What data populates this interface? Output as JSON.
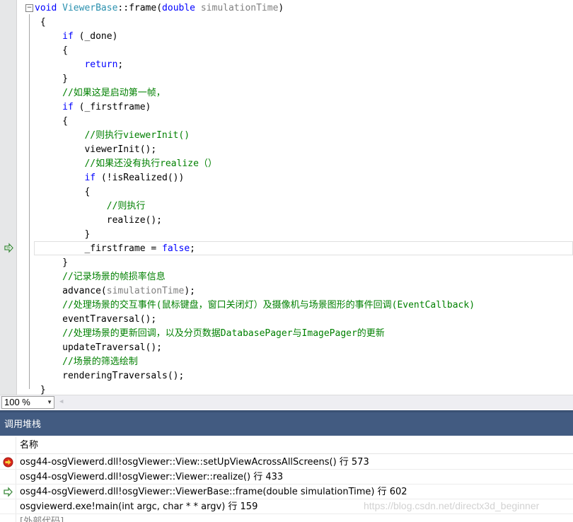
{
  "editor": {
    "lines": [
      [
        {
          "t": "void",
          "c": "kw"
        },
        {
          "t": " "
        },
        {
          "t": "ViewerBase",
          "c": "ty"
        },
        {
          "t": "::frame("
        },
        {
          "t": "double",
          "c": "kw"
        },
        {
          "t": " "
        },
        {
          "t": "simulationTime",
          "c": "pm"
        },
        {
          "t": ")"
        }
      ],
      [
        {
          "t": " {"
        }
      ],
      [
        {
          "t": "     "
        },
        {
          "t": "if",
          "c": "kw"
        },
        {
          "t": " (_done)"
        }
      ],
      [
        {
          "t": "     {"
        }
      ],
      [
        {
          "t": "         "
        },
        {
          "t": "return",
          "c": "kw"
        },
        {
          "t": ";"
        }
      ],
      [
        {
          "t": "     }"
        }
      ],
      [
        {
          "t": "     "
        },
        {
          "t": "//如果这是启动第一帧，",
          "c": "cm"
        }
      ],
      [
        {
          "t": "     "
        },
        {
          "t": "if",
          "c": "kw"
        },
        {
          "t": " (_firstframe)"
        }
      ],
      [
        {
          "t": "     {"
        }
      ],
      [
        {
          "t": "         "
        },
        {
          "t": "//则执行viewerInit()",
          "c": "cm"
        }
      ],
      [
        {
          "t": "         viewerInit();"
        }
      ],
      [
        {
          "t": "         "
        },
        {
          "t": "//如果还没有执行realize（）",
          "c": "cm"
        }
      ],
      [
        {
          "t": "         "
        },
        {
          "t": "if",
          "c": "kw"
        },
        {
          "t": " (!isRealized())"
        }
      ],
      [
        {
          "t": "         {"
        }
      ],
      [
        {
          "t": "             "
        },
        {
          "t": "//则执行",
          "c": "cm"
        }
      ],
      [
        {
          "t": "             realize();"
        }
      ],
      [
        {
          "t": "         }"
        }
      ],
      [
        {
          "t": "         _firstframe = "
        },
        {
          "t": "false",
          "c": "kw"
        },
        {
          "t": ";"
        }
      ],
      [
        {
          "t": "     }"
        }
      ],
      [
        {
          "t": "     "
        },
        {
          "t": "//记录场景的帧损率信息",
          "c": "cm"
        }
      ],
      [
        {
          "t": "     advance("
        },
        {
          "t": "simulationTime",
          "c": "pm"
        },
        {
          "t": ");"
        }
      ],
      [
        {
          "t": "     "
        },
        {
          "t": "//处理场景的交互事件(鼠标键盘，窗口关闭灯）及摄像机与场景图形的事件回调(EventCallback)",
          "c": "cm"
        }
      ],
      [
        {
          "t": "     eventTraversal();"
        }
      ],
      [
        {
          "t": "     "
        },
        {
          "t": "//处理场景的更新回调，以及分页数据DatabasePager与ImagePager的更新",
          "c": "cm"
        }
      ],
      [
        {
          "t": "     updateTraversal();"
        }
      ],
      [
        {
          "t": "     "
        },
        {
          "t": "//场景的筛选绘制",
          "c": "cm"
        }
      ],
      [
        {
          "t": "     renderingTraversals();"
        }
      ],
      [
        {
          "t": " }"
        }
      ]
    ],
    "fold_symbol": "−",
    "current_line_icon": "return-arrow-icon"
  },
  "zoom": {
    "value": "100 %",
    "dropdown_icon": "chevron-down-icon"
  },
  "call_stack": {
    "title": "调用堆栈",
    "column_name": "名称",
    "rows": [
      {
        "text": "osg44-osgViewerd.dll!osgViewer::View::setUpViewAcrossAllScreens() 行 573",
        "icon": "breakpoint-arrow-icon"
      },
      {
        "text": "osg44-osgViewerd.dll!osgViewer::Viewer::realize() 行 433",
        "icon": ""
      },
      {
        "text": "osg44-osgViewerd.dll!osgViewer::ViewerBase::frame(double simulationTime) 行 602",
        "icon": "return-arrow-icon"
      },
      {
        "text": "osgviewerd.exe!main(int argc, char * * argv) 行 159",
        "icon": ""
      },
      {
        "text": "[外部代码]",
        "icon": ""
      }
    ],
    "watermark": "https://blog.csdn.net/directx3d_beginner"
  },
  "colors": {
    "keyword": "#0000ff",
    "type": "#2b91af",
    "comment": "#008000",
    "panel_header": "#425b81"
  }
}
